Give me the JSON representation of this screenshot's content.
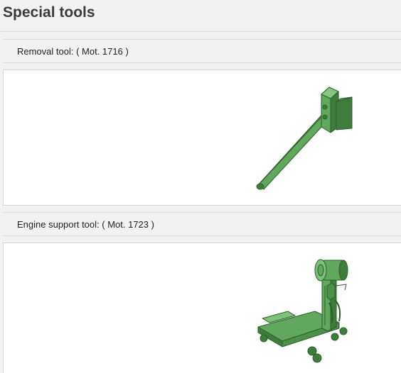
{
  "page": {
    "title": "Special tools"
  },
  "sections": [
    {
      "label": "Removal tool: ( Mot. 1716 )",
      "illustration": "removal-tool"
    },
    {
      "label": "Engine support tool: ( Mot. 1723 )",
      "illustration": "engine-support-tool"
    }
  ],
  "colors": {
    "tool_fill": "#5fa85c",
    "tool_dark": "#3f7d3c",
    "tool_stroke": "#2f5e2d"
  }
}
